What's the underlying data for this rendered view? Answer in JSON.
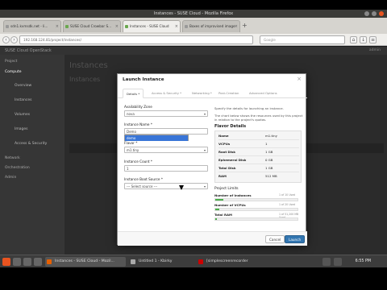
{
  "window": {
    "title": "Instances - SUSE Cloud - Mozilla Firefox"
  },
  "browser": {
    "tabs": [
      {
        "label": "sdn1.kvmsdk.net - li..."
      },
      {
        "label": "SUSE Cloud Crowbar S..."
      },
      {
        "label": "Instances - SUSE Cloud"
      },
      {
        "label": "Boxes of improvised image"
      }
    ],
    "url": "192.168.124.81/project/instances/",
    "search_placeholder": "Google"
  },
  "app": {
    "brand": "SUSE Cloud OpenStack",
    "user": "admin",
    "sidebar": [
      {
        "label": "Project"
      },
      {
        "label": "Compute"
      },
      {
        "label": "Overview"
      },
      {
        "label": "Instances"
      },
      {
        "label": "Volumes"
      },
      {
        "label": "Images"
      },
      {
        "label": "Access & Security"
      },
      {
        "label": "Network"
      },
      {
        "label": "Orchestration"
      },
      {
        "label": "Admin"
      }
    ],
    "page_title": "Instances",
    "page_sub": "Instances"
  },
  "modal": {
    "title": "Launch Instance",
    "tabs": [
      {
        "label": "Details *"
      },
      {
        "label": "Access & Security *"
      },
      {
        "label": "Networking *"
      },
      {
        "label": "Post-Creation"
      },
      {
        "label": "Advanced Options"
      }
    ],
    "availability_zone_label": "Availability Zone",
    "availability_zone_value": "nova",
    "instance_name_label": "Instance Name *",
    "instance_name_options": [
      "Demo",
      "demo"
    ],
    "flavor_label": "Flavor *",
    "flavor_value": "m1.tiny",
    "instance_count_label": "Instance Count *",
    "instance_count_value": "1",
    "boot_source_label": "Instance Boot Source *",
    "boot_source_value": "--- Select source ---",
    "hint_1": "Specify the details for launching an instance.",
    "hint_2": "The chart below shows the resources used by this project in relation to the project's quotas.",
    "flavor_details_title": "Flavor Details",
    "flavor_details": [
      {
        "key": "Name",
        "value": "m1.tiny"
      },
      {
        "key": "VCPUs",
        "value": "1"
      },
      {
        "key": "Root Disk",
        "value": "1 GB"
      },
      {
        "key": "Ephemeral Disk",
        "value": "0 GB"
      },
      {
        "key": "Total Disk",
        "value": "1 GB"
      },
      {
        "key": "RAM",
        "value": "512 MB"
      }
    ],
    "project_limits_title": "Project Limits",
    "limits": [
      {
        "label": "Number of Instances",
        "used": "1 of 10 Used",
        "fraction": 0.1
      },
      {
        "label": "Number of VCPUs",
        "used": "1 of 20 Used",
        "fraction": 0.05
      },
      {
        "label": "Total RAM",
        "used": "1 of 51,200 MB Used",
        "fraction": 0.01
      }
    ],
    "cancel_label": "Cancel",
    "launch_label": "Launch"
  },
  "taskbar": {
    "tasks": [
      {
        "label": "Instances - SUSE Cloud - Mozil..."
      },
      {
        "label": "Untitled 1 - Kbirky"
      },
      {
        "label": "[simplescreenrecorder"
      }
    ],
    "clock": "6:55 PM"
  }
}
